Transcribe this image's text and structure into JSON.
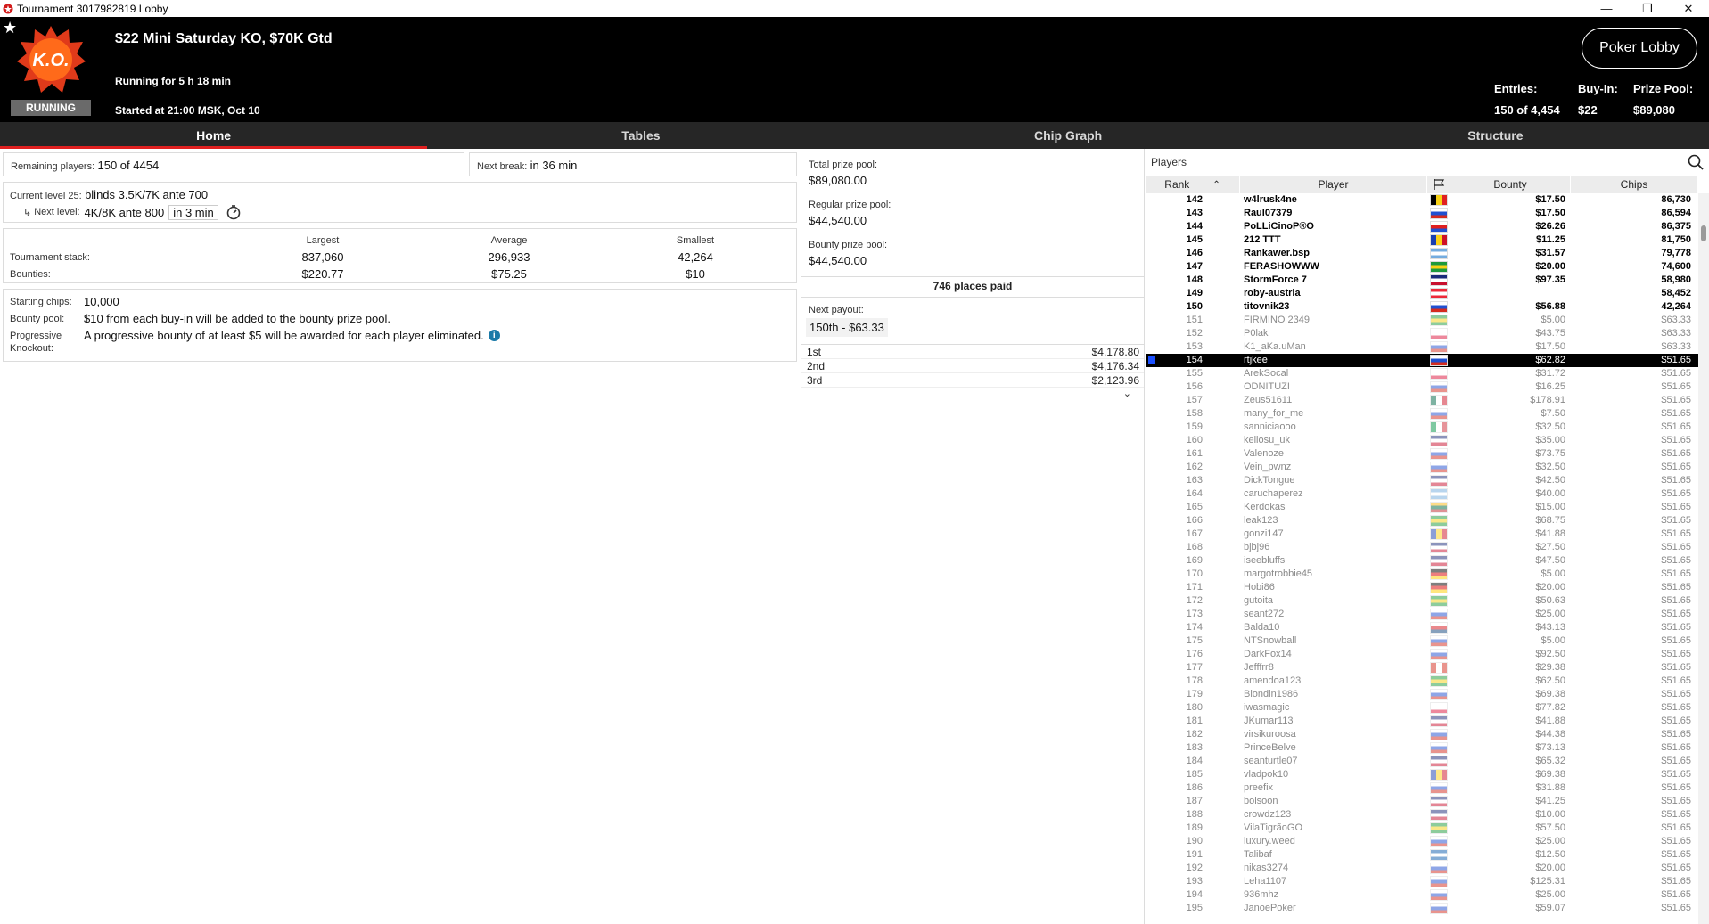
{
  "window": {
    "title": "Tournament 3017982819 Lobby",
    "controls": [
      "—",
      "❐",
      "✕"
    ]
  },
  "header": {
    "tournament_name": "$22 Mini Saturday KO, $70K Gtd",
    "running_for": "Running for 5 h 18 min",
    "started_at": "Started at 21:00 MSK, Oct 10",
    "status": "RUNNING",
    "logo_text": "K.O.",
    "poker_lobby_label": "Poker Lobby",
    "entries_label": "Entries:",
    "entries_value": "150 of 4,454",
    "buyin_label": "Buy-In:",
    "buyin_value": "$22",
    "prizepool_label": "Prize Pool:",
    "prizepool_value": "$89,080"
  },
  "tabs": [
    {
      "label": "Home",
      "active": true
    },
    {
      "label": "Tables",
      "active": false
    },
    {
      "label": "Chip Graph",
      "active": false
    },
    {
      "label": "Structure",
      "active": false
    }
  ],
  "home": {
    "remaining_label": "Remaining players:",
    "remaining_value": "150 of 4454",
    "next_break_label": "Next break:",
    "next_break_value": "in 36 min",
    "current_level_label": "Current level 25:",
    "current_level_value": "blinds 3.5K/7K ante 700",
    "next_level_label": "Next level:",
    "next_level_value": "4K/8K ante 800",
    "next_level_time": "in 3 min",
    "stats": {
      "largest_label": "Largest",
      "average_label": "Average",
      "smallest_label": "Smallest",
      "stack_label": "Tournament stack:",
      "bounties_label": "Bounties:",
      "stack_largest": "837,060",
      "stack_average": "296,933",
      "stack_smallest": "42,264",
      "bounty_largest": "$220.77",
      "bounty_average": "$75.25",
      "bounty_smallest": "$10"
    },
    "starting_chips_label": "Starting chips:",
    "starting_chips_value": "10,000",
    "bounty_pool_label": "Bounty pool:",
    "bounty_pool_value": "$10 from each buy-in will be added to the bounty prize pool.",
    "progressive_label_1": "Progressive",
    "progressive_label_2": "Knockout:",
    "progressive_value": "A progressive bounty of at least $5 will be awarded for each player eliminated."
  },
  "prizes": {
    "total_label": "Total prize pool:",
    "total_value": "$89,080.00",
    "regular_label": "Regular prize pool:",
    "regular_value": "$44,540.00",
    "bounty_label": "Bounty prize pool:",
    "bounty_value": "$44,540.00",
    "places_paid": "746 places paid",
    "next_payout_label": "Next payout:",
    "next_payout_value": "150th - $63.33",
    "payouts": [
      {
        "place": "1st",
        "amount": "$4,178.80"
      },
      {
        "place": "2nd",
        "amount": "$4,176.34"
      },
      {
        "place": "3rd",
        "amount": "$2,123.96"
      }
    ]
  },
  "players_panel": {
    "title": "Players",
    "col_rank": "Rank",
    "col_player": "Player",
    "col_bounty": "Bounty",
    "col_chips": "Chips",
    "rows": [
      {
        "rank": "142",
        "name": "w4lrusk4ne",
        "bounty": "$17.50",
        "chips": "86,730",
        "state": "active",
        "flag": [
          "#000000",
          "#f7d116",
          "#e02020"
        ],
        "dir": "v"
      },
      {
        "rank": "143",
        "name": "Raul07379",
        "bounty": "$17.50",
        "chips": "86,594",
        "state": "active",
        "flag": [
          "#ffffff",
          "#2050d0",
          "#d52b1e"
        ],
        "dir": "h"
      },
      {
        "rank": "144",
        "name": "PoLLiCinoP®O",
        "bounty": "$26.26",
        "chips": "86,375",
        "state": "active",
        "flag": [
          "#ffffff",
          "#e02020",
          "#2050d0"
        ],
        "dir": "h"
      },
      {
        "rank": "145",
        "name": "212 TTT",
        "bounty": "$11.25",
        "chips": "81,750",
        "state": "active",
        "flag": [
          "#1a3fb0",
          "#fcd116",
          "#ce1126"
        ],
        "dir": "v"
      },
      {
        "rank": "146",
        "name": "Rankawer.bsp",
        "bounty": "$31.57",
        "chips": "79,778",
        "state": "active",
        "flag": [
          "#74acdf",
          "#ffffff",
          "#74acdf"
        ],
        "dir": "h"
      },
      {
        "rank": "147",
        "name": "FERASHOWWW",
        "bounty": "$20.00",
        "chips": "74,600",
        "state": "active",
        "flag": [
          "#1e9a3c",
          "#f7d116",
          "#1e9a3c"
        ],
        "dir": "h"
      },
      {
        "rank": "148",
        "name": "StormForce 7",
        "bounty": "$97.35",
        "chips": "58,980",
        "state": "active",
        "flag": [
          "#1a2a7a",
          "#ffffff",
          "#c8102e"
        ],
        "dir": "h"
      },
      {
        "rank": "149",
        "name": "roby-austria",
        "bounty": "",
        "chips": "58,452",
        "state": "active",
        "flag": [
          "#ed2939",
          "#ffffff",
          "#ed2939"
        ],
        "dir": "h"
      },
      {
        "rank": "150",
        "name": "titovnik23",
        "bounty": "$56.88",
        "chips": "42,264",
        "state": "active",
        "flag": [
          "#ffffff",
          "#2050d0",
          "#d52b1e"
        ],
        "dir": "h"
      },
      {
        "rank": "151",
        "name": "FIRMINO 2349",
        "bounty": "$5.00",
        "chips": "$63.33",
        "state": "elim",
        "flag": [
          "#1e9a3c",
          "#f7d116",
          "#1e9a3c"
        ],
        "dir": "h"
      },
      {
        "rank": "152",
        "name": "P0lak",
        "bounty": "$43.75",
        "chips": "$63.33",
        "state": "elim",
        "flag": [
          "#ffffff",
          "#ffffff",
          "#dc143c"
        ],
        "dir": "h"
      },
      {
        "rank": "153",
        "name": "K1_aKa.uMan",
        "bounty": "$17.50",
        "chips": "$63.33",
        "state": "elim",
        "flag": [
          "#ffffff",
          "#2050d0",
          "#d52b1e"
        ],
        "dir": "h"
      },
      {
        "rank": "154",
        "name": "rtjkee",
        "bounty": "$62.82",
        "chips": "$51.65",
        "state": "me",
        "flag": [
          "#ffffff",
          "#2050d0",
          "#d52b1e"
        ],
        "dir": "h"
      },
      {
        "rank": "155",
        "name": "ArekSocal",
        "bounty": "$31.72",
        "chips": "$51.65",
        "state": "elim",
        "flag": [
          "#ffffff",
          "#ffffff",
          "#dc143c"
        ],
        "dir": "h"
      },
      {
        "rank": "156",
        "name": "ODNITUZI",
        "bounty": "$16.25",
        "chips": "$51.65",
        "state": "elim",
        "flag": [
          "#ffffff",
          "#2050d0",
          "#d52b1e"
        ],
        "dir": "h"
      },
      {
        "rank": "157",
        "name": "Zeus51611",
        "bounty": "$178.91",
        "chips": "$51.65",
        "state": "elim",
        "flag": [
          "#006847",
          "#ffffff",
          "#ce1126"
        ],
        "dir": "v"
      },
      {
        "rank": "158",
        "name": "many_for_me",
        "bounty": "$7.50",
        "chips": "$51.65",
        "state": "elim",
        "flag": [
          "#ffffff",
          "#2050d0",
          "#d52b1e"
        ],
        "dir": "h"
      },
      {
        "rank": "159",
        "name": "sanniciaooo",
        "bounty": "$32.50",
        "chips": "$51.65",
        "state": "elim",
        "flag": [
          "#009246",
          "#ffffff",
          "#ce2b37"
        ],
        "dir": "v"
      },
      {
        "rank": "160",
        "name": "keliosu_uk",
        "bounty": "$35.00",
        "chips": "$51.65",
        "state": "elim",
        "flag": [
          "#1a2a7a",
          "#ffffff",
          "#c8102e"
        ],
        "dir": "h"
      },
      {
        "rank": "161",
        "name": "Valenoze",
        "bounty": "$73.75",
        "chips": "$51.65",
        "state": "elim",
        "flag": [
          "#ffffff",
          "#2050d0",
          "#d52b1e"
        ],
        "dir": "h"
      },
      {
        "rank": "162",
        "name": "Vein_pwnz",
        "bounty": "$32.50",
        "chips": "$51.65",
        "state": "elim",
        "flag": [
          "#ffffff",
          "#2050d0",
          "#d52b1e"
        ],
        "dir": "h"
      },
      {
        "rank": "163",
        "name": "DickTongue",
        "bounty": "$42.50",
        "chips": "$51.65",
        "state": "elim",
        "flag": [
          "#1a2a7a",
          "#ffffff",
          "#c8102e"
        ],
        "dir": "h"
      },
      {
        "rank": "164",
        "name": "caruchaperez",
        "bounty": "$40.00",
        "chips": "$51.65",
        "state": "elim",
        "flag": [
          "#74acdf",
          "#ffffff",
          "#74acdf"
        ],
        "dir": "h"
      },
      {
        "rank": "165",
        "name": "Kerdokas",
        "bounty": "$15.00",
        "chips": "$51.65",
        "state": "elim",
        "flag": [
          "#fdb913",
          "#006a44",
          "#c1272d"
        ],
        "dir": "h"
      },
      {
        "rank": "166",
        "name": "leak123",
        "bounty": "$68.75",
        "chips": "$51.65",
        "state": "elim",
        "flag": [
          "#1e9a3c",
          "#f7d116",
          "#1e9a3c"
        ],
        "dir": "h"
      },
      {
        "rank": "167",
        "name": "gonzi147",
        "bounty": "$41.88",
        "chips": "$51.65",
        "state": "elim",
        "flag": [
          "#1a3fb0",
          "#fcd116",
          "#ce1126"
        ],
        "dir": "v"
      },
      {
        "rank": "168",
        "name": "bjbj96",
        "bounty": "$27.50",
        "chips": "$51.65",
        "state": "elim",
        "flag": [
          "#1a2a7a",
          "#ffffff",
          "#c8102e"
        ],
        "dir": "h"
      },
      {
        "rank": "169",
        "name": "iseebluffs",
        "bounty": "$47.50",
        "chips": "$51.65",
        "state": "elim",
        "flag": [
          "#1a2a7a",
          "#ffffff",
          "#c8102e"
        ],
        "dir": "h"
      },
      {
        "rank": "170",
        "name": "margotrobbie45",
        "bounty": "$5.00",
        "chips": "$51.65",
        "state": "elim",
        "flag": [
          "#000000",
          "#dd0000",
          "#ffce00"
        ],
        "dir": "h"
      },
      {
        "rank": "171",
        "name": "Hobi86",
        "bounty": "$20.00",
        "chips": "$51.65",
        "state": "elim",
        "flag": [
          "#000000",
          "#dd0000",
          "#ffce00"
        ],
        "dir": "h"
      },
      {
        "rank": "172",
        "name": "gutoita",
        "bounty": "$50.63",
        "chips": "$51.65",
        "state": "elim",
        "flag": [
          "#1e9a3c",
          "#f7d116",
          "#1e9a3c"
        ],
        "dir": "h"
      },
      {
        "rank": "173",
        "name": "seant272",
        "bounty": "$25.00",
        "chips": "$51.65",
        "state": "elim",
        "flag": [
          "#ffffff",
          "#2050d0",
          "#d52b1e"
        ],
        "dir": "h"
      },
      {
        "rank": "174",
        "name": "Balda10",
        "bounty": "$43.13",
        "chips": "$51.65",
        "state": "elim",
        "flag": [
          "#ffffff",
          "#d7141a",
          "#11457e"
        ],
        "dir": "h"
      },
      {
        "rank": "175",
        "name": "NTSnowball",
        "bounty": "$5.00",
        "chips": "$51.65",
        "state": "elim",
        "flag": [
          "#ffffff",
          "#2050d0",
          "#d52b1e"
        ],
        "dir": "h"
      },
      {
        "rank": "176",
        "name": "DarkFox14",
        "bounty": "$92.50",
        "chips": "$51.65",
        "state": "elim",
        "flag": [
          "#ffffff",
          "#2050d0",
          "#d52b1e"
        ],
        "dir": "h"
      },
      {
        "rank": "177",
        "name": "Jefffrr8",
        "bounty": "$29.38",
        "chips": "$51.65",
        "state": "elim",
        "flag": [
          "#d52b1e",
          "#ffffff",
          "#d52b1e"
        ],
        "dir": "v"
      },
      {
        "rank": "178",
        "name": "amendoa123",
        "bounty": "$62.50",
        "chips": "$51.65",
        "state": "elim",
        "flag": [
          "#1e9a3c",
          "#f7d116",
          "#1e9a3c"
        ],
        "dir": "h"
      },
      {
        "rank": "179",
        "name": "Blondin1986",
        "bounty": "$69.38",
        "chips": "$51.65",
        "state": "elim",
        "flag": [
          "#ffffff",
          "#2050d0",
          "#d52b1e"
        ],
        "dir": "h"
      },
      {
        "rank": "180",
        "name": "iwasmagic",
        "bounty": "$77.82",
        "chips": "$51.65",
        "state": "elim",
        "flag": [
          "#ffffff",
          "#ffffff",
          "#dc143c"
        ],
        "dir": "h"
      },
      {
        "rank": "181",
        "name": "JKumar113",
        "bounty": "$41.88",
        "chips": "$51.65",
        "state": "elim",
        "flag": [
          "#1a2a7a",
          "#ffffff",
          "#c8102e"
        ],
        "dir": "h"
      },
      {
        "rank": "182",
        "name": "virsikuroosa",
        "bounty": "$44.38",
        "chips": "$51.65",
        "state": "elim",
        "flag": [
          "#ffffff",
          "#2050d0",
          "#d52b1e"
        ],
        "dir": "h"
      },
      {
        "rank": "183",
        "name": "PrinceBelve",
        "bounty": "$73.13",
        "chips": "$51.65",
        "state": "elim",
        "flag": [
          "#ffffff",
          "#2050d0",
          "#d52b1e"
        ],
        "dir": "h"
      },
      {
        "rank": "184",
        "name": "seanturtle07",
        "bounty": "$65.32",
        "chips": "$51.65",
        "state": "elim",
        "flag": [
          "#1a2a7a",
          "#ffffff",
          "#c8102e"
        ],
        "dir": "h"
      },
      {
        "rank": "185",
        "name": "vladpok10",
        "bounty": "$69.38",
        "chips": "$51.65",
        "state": "elim",
        "flag": [
          "#1a3fb0",
          "#fcd116",
          "#ce1126"
        ],
        "dir": "v"
      },
      {
        "rank": "186",
        "name": "preefix",
        "bounty": "$31.88",
        "chips": "$51.65",
        "state": "elim",
        "flag": [
          "#ffffff",
          "#2050d0",
          "#d52b1e"
        ],
        "dir": "h"
      },
      {
        "rank": "187",
        "name": "bolsoon",
        "bounty": "$41.25",
        "chips": "$51.65",
        "state": "elim",
        "flag": [
          "#1a2a7a",
          "#ffffff",
          "#c8102e"
        ],
        "dir": "h"
      },
      {
        "rank": "188",
        "name": "crowdz123",
        "bounty": "$10.00",
        "chips": "$51.65",
        "state": "elim",
        "flag": [
          "#1a2a7a",
          "#ffffff",
          "#c8102e"
        ],
        "dir": "h"
      },
      {
        "rank": "189",
        "name": "VilaTigrãoGO",
        "bounty": "$57.50",
        "chips": "$51.65",
        "state": "elim",
        "flag": [
          "#1e9a3c",
          "#f7d116",
          "#1e9a3c"
        ],
        "dir": "h"
      },
      {
        "rank": "190",
        "name": "luxury.weed",
        "bounty": "$25.00",
        "chips": "$51.65",
        "state": "elim",
        "flag": [
          "#ffffff",
          "#2050d0",
          "#d52b1e"
        ],
        "dir": "h"
      },
      {
        "rank": "191",
        "name": "Talibaf",
        "bounty": "$12.50",
        "chips": "$51.65",
        "state": "elim",
        "flag": [
          "#0d5eaf",
          "#ffffff",
          "#0d5eaf"
        ],
        "dir": "h"
      },
      {
        "rank": "192",
        "name": "nikas3274",
        "bounty": "$20.00",
        "chips": "$51.65",
        "state": "elim",
        "flag": [
          "#ffffff",
          "#2050d0",
          "#d52b1e"
        ],
        "dir": "h"
      },
      {
        "rank": "193",
        "name": "Leha1107",
        "bounty": "$125.31",
        "chips": "$51.65",
        "state": "elim",
        "flag": [
          "#ffffff",
          "#2050d0",
          "#d52b1e"
        ],
        "dir": "h"
      },
      {
        "rank": "194",
        "name": "936mhz",
        "bounty": "$25.00",
        "chips": "$51.65",
        "state": "elim",
        "flag": [
          "#ffffff",
          "#2050d0",
          "#d52b1e"
        ],
        "dir": "h"
      },
      {
        "rank": "195",
        "name": "JanoePoker",
        "bounty": "$59.07",
        "chips": "$51.65",
        "state": "elim",
        "flag": [
          "#ffffff",
          "#2050d0",
          "#d52b1e"
        ],
        "dir": "h"
      }
    ]
  }
}
